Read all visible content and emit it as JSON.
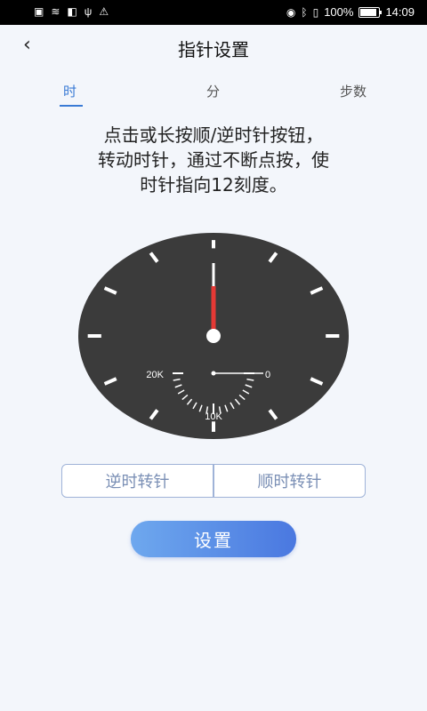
{
  "status_bar": {
    "battery_text": "100%",
    "time": "14:09",
    "icons": [
      "sim-icon",
      "wifi-icon",
      "nfc-icon",
      "usb-icon",
      "warning-icon",
      "eye-icon",
      "bluetooth-icon",
      "vibrate-icon",
      "battery-icon"
    ]
  },
  "header": {
    "back_label": "‹",
    "title": "指针设置"
  },
  "tabs": [
    {
      "label": "时",
      "active": true
    },
    {
      "label": "分",
      "active": false
    },
    {
      "label": "步数",
      "active": false
    }
  ],
  "instruction": "点击或长按顺/逆时针按钮，转动时针，通过不断点按，使时针指向12刻度。",
  "dial": {
    "labels": {
      "left": "20K",
      "right": "0",
      "bottom": "10K"
    },
    "hand_color": "#e53935",
    "hand_position": 0
  },
  "buttons": {
    "counterclockwise": "逆时转针",
    "clockwise": "顺时转针",
    "set": "设置"
  }
}
